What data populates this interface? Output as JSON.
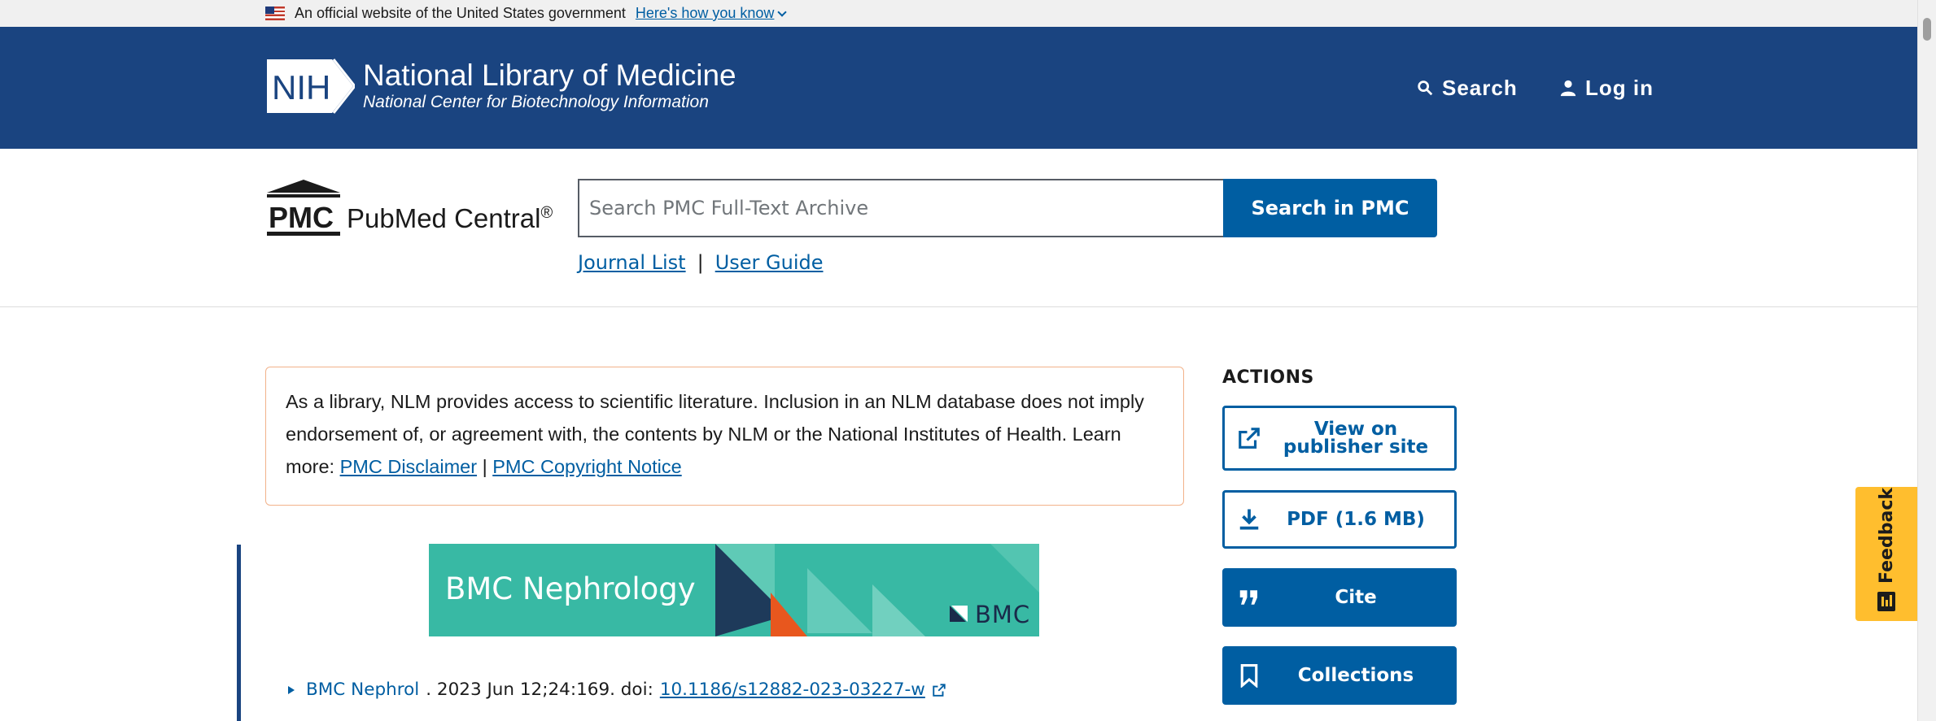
{
  "gov_banner": {
    "text": "An official website of the United States government",
    "link": "Here's how you know",
    "flag_icon": "us-flag-icon"
  },
  "header": {
    "logo_badge": "NIH",
    "title": "National Library of Medicine",
    "subtitle": "National Center for Biotechnology Information",
    "search_label": "Search",
    "login_label": "Log in",
    "background_color": "#1a4480"
  },
  "pmc": {
    "logo_mark": "PMC",
    "name": "PubMed Central",
    "registered": "®",
    "search_placeholder": "Search PMC Full-Text Archive",
    "search_button": "Search in PMC",
    "links": [
      {
        "label": "Journal List"
      },
      {
        "label": "User Guide"
      }
    ],
    "link_separator": "|"
  },
  "disclaimer": {
    "text": "As a library, NLM provides access to scientific literature. Inclusion in an NLM database does not imply endorsement of, or agreement with, the contents by NLM or the National Institutes of Health.",
    "learn_more": "Learn more:",
    "link1": "PMC Disclaimer",
    "separator": "|",
    "link2": "PMC Copyright Notice"
  },
  "article": {
    "journal_banner_title": "BMC Nephrology",
    "journal_banner_brand": "BMC",
    "citation_journal": "BMC Nephrol",
    "citation_details": ". 2023 Jun 12;24:169. doi: ",
    "doi": "10.1186/s12882-023-03227-w"
  },
  "actions": {
    "heading": "ACTIONS",
    "view_publisher_line1": "View on",
    "view_publisher_line2": "publisher site",
    "pdf": "PDF (1.6 MB)",
    "cite": "Cite",
    "collections": "Collections"
  },
  "feedback": {
    "label": "Feedback"
  },
  "colors": {
    "primary": "#005ea2",
    "navy": "#1a4480",
    "feedback": "#ffbe2e",
    "banner_teal": "#38b9a4"
  }
}
